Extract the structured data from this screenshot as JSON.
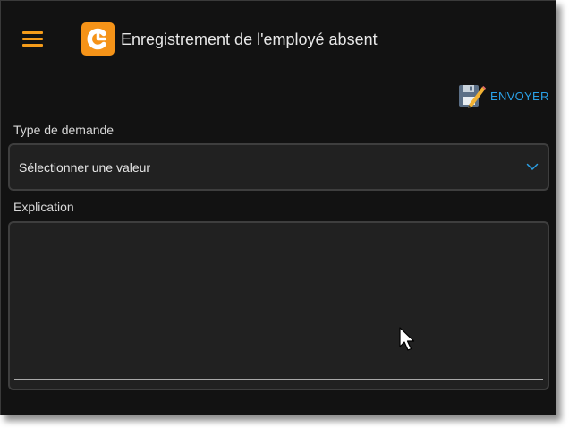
{
  "header": {
    "title": "Enregistrement de l'employé absent",
    "menu_icon": "hamburger-menu-icon",
    "logo_icon": "app-logo-icon",
    "accent_color": "#f59c1a"
  },
  "toolbar": {
    "send_label": "ENVOYER",
    "send_icon": "save-edit-icon",
    "send_color": "#2aa0e6"
  },
  "form": {
    "type_label": "Type de demande",
    "type_value": "Sélectionner une valeur",
    "type_icon": "chevron-down-icon",
    "explication_label": "Explication",
    "explication_value": ""
  }
}
